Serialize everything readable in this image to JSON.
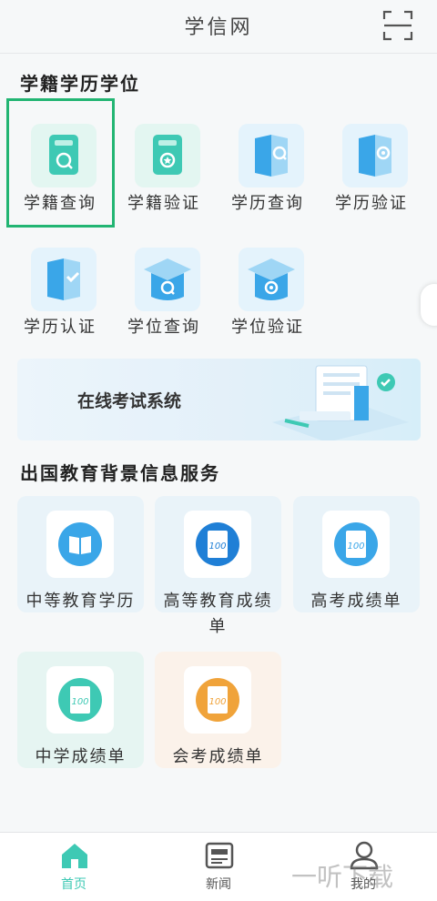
{
  "header": {
    "title": "学信网",
    "scan_icon": "scan-icon"
  },
  "section1": {
    "title": "学籍学历学位",
    "items": [
      {
        "label": "学籍查询",
        "icon": "student-status-query-icon"
      },
      {
        "label": "学籍验证",
        "icon": "student-status-verify-icon"
      },
      {
        "label": "学历查询",
        "icon": "education-query-icon"
      },
      {
        "label": "学历验证",
        "icon": "education-verify-icon"
      },
      {
        "label": "学历认证",
        "icon": "education-cert-icon"
      },
      {
        "label": "学位查询",
        "icon": "degree-query-icon"
      },
      {
        "label": "学位验证",
        "icon": "degree-verify-icon"
      }
    ]
  },
  "banner": {
    "text": "在线考试系统"
  },
  "section2": {
    "title": "出国教育背景信息服务",
    "cards": [
      {
        "label": "中等教育学历"
      },
      {
        "label": "高等教育成绩单"
      },
      {
        "label": "高考成绩单"
      },
      {
        "label": "中学成绩单"
      },
      {
        "label": "会考成绩单"
      }
    ]
  },
  "bottom_nav": [
    {
      "label": "首页",
      "icon": "home-icon",
      "active": true
    },
    {
      "label": "新闻",
      "icon": "news-icon"
    },
    {
      "label": "我的",
      "icon": "user-icon"
    }
  ],
  "watermark": "一听下载",
  "colors": {
    "accent": "#22b573",
    "teal": "#3ec9b4",
    "blue": "#3aa6e8",
    "orange": "#f0a33a"
  }
}
